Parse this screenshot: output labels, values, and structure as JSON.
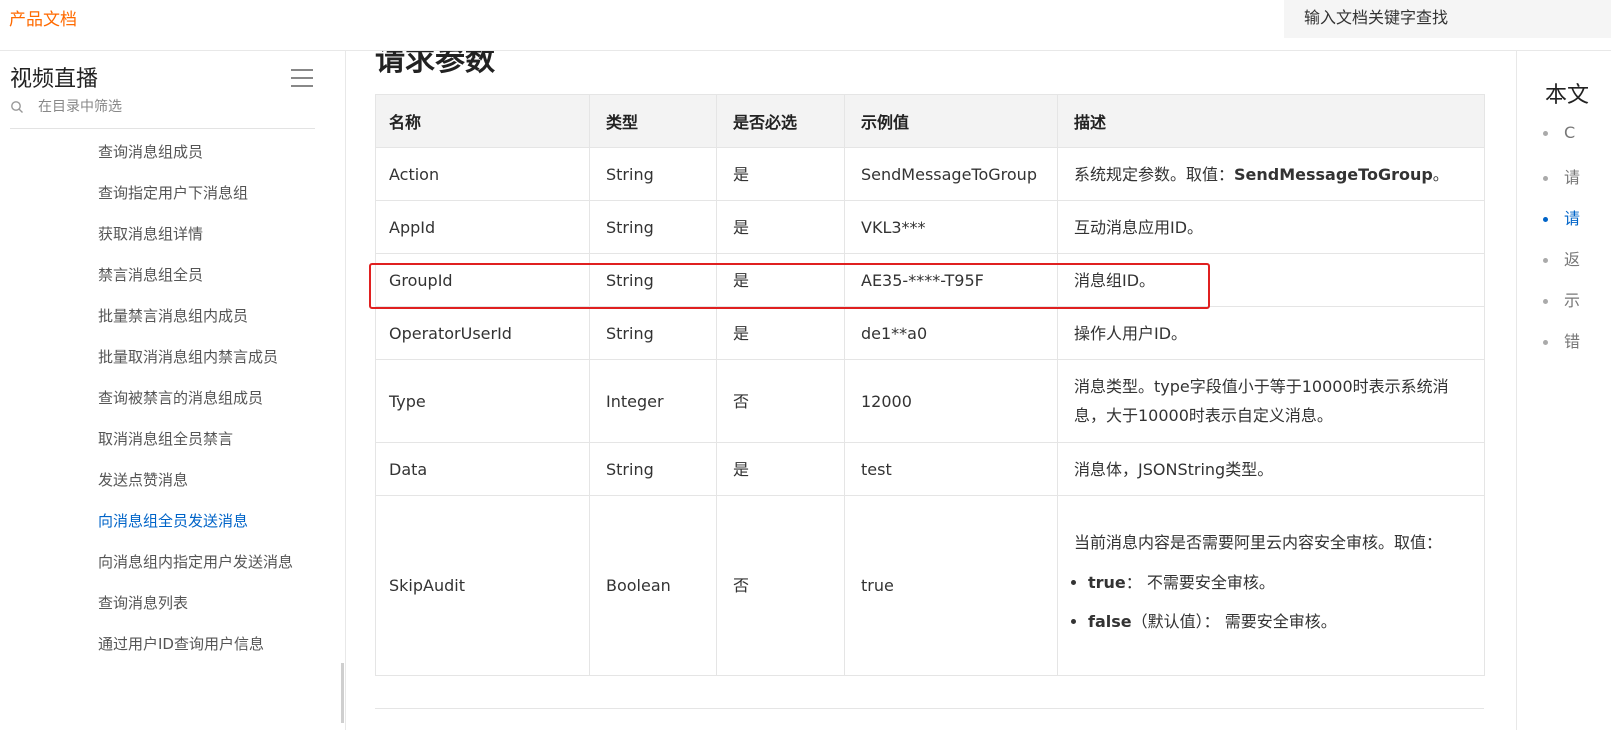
{
  "header": {
    "brand": "产品文档",
    "search_placeholder": "输入文档关键字查找"
  },
  "sidebar": {
    "title": "视频直播",
    "filter_placeholder": "在目录中筛选",
    "items": [
      "查询消息组成员",
      "查询指定用户下消息组",
      "获取消息组详情",
      "禁言消息组全员",
      "批量禁言消息组内成员",
      "批量取消消息组内禁言成员",
      "查询被禁言的消息组成员",
      "取消消息组全员禁言",
      "发送点赞消息",
      "向消息组全员发送消息",
      "向消息组内指定用户发送消息",
      "查询消息列表",
      "通过用户ID查询用户信息"
    ],
    "active_item": "向消息组全员发送消息"
  },
  "main": {
    "heading": "请求参数",
    "table": {
      "headers": [
        "名称",
        "类型",
        "是否必选",
        "示例值",
        "描述"
      ],
      "rows": [
        {
          "name": "Action",
          "type": "String",
          "required": "是",
          "example": "SendMessageToGroup",
          "desc_prefix": "系统规定参数。取值：",
          "desc_bold": "SendMessageToGroup",
          "desc_suffix": "。"
        },
        {
          "name": "AppId",
          "type": "String",
          "required": "是",
          "example": "VKL3***",
          "desc": "互动消息应用ID。"
        },
        {
          "name": "GroupId",
          "type": "String",
          "required": "是",
          "example": "AE35-****-T95F",
          "desc": "消息组ID。"
        },
        {
          "name": "OperatorUserId",
          "type": "String",
          "required": "是",
          "example": "de1**a0",
          "desc": "操作人用户ID。"
        },
        {
          "name": "Type",
          "type": "Integer",
          "required": "否",
          "example": "12000",
          "desc": "消息类型。type字段值小于等于10000时表示系统消息，大于10000时表示自定义消息。"
        },
        {
          "name": "Data",
          "type": "String",
          "required": "是",
          "example": "test",
          "desc": "消息体，JSONString类型。"
        },
        {
          "name": "SkipAudit",
          "type": "Boolean",
          "required": "否",
          "example": "true",
          "desc": "当前消息内容是否需要阿里云内容安全审核。取值：",
          "options": [
            {
              "key": "true",
              "text": "： 不需要安全审核。"
            },
            {
              "key": "false",
              "text": "（默认值）： 需要安全审核。"
            }
          ]
        }
      ]
    },
    "highlighted_row": "GroupId",
    "highlight_color": "#e02020"
  },
  "toc": {
    "title": "本文",
    "items": [
      "C",
      "请",
      "请",
      "返",
      "示",
      "错"
    ],
    "active_index": 2
  },
  "colors": {
    "brand": "#ff6a00",
    "link_active": "#0064c8"
  }
}
